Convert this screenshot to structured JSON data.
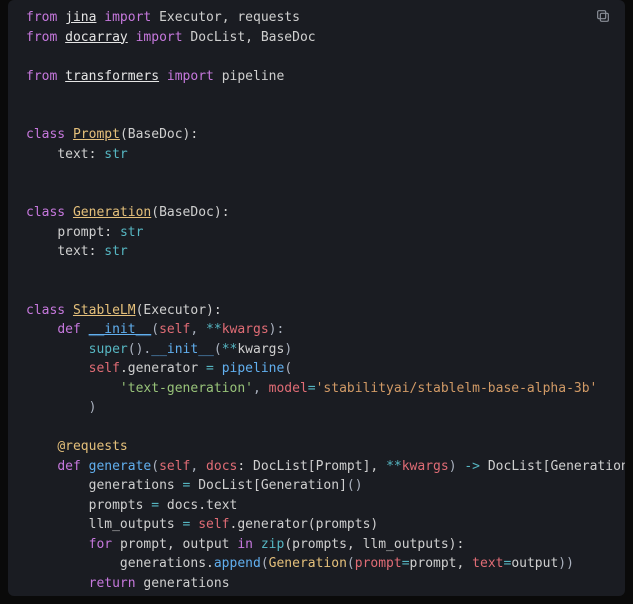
{
  "lines": {
    "l1_from": "from ",
    "l1_mod": "jina",
    "l1_imp": " import ",
    "l1_sym": "Executor, requests",
    "l2_from": "from ",
    "l2_mod": "docarray",
    "l2_imp": " import ",
    "l2_sym": "DocList, BaseDoc",
    "l3_from": "from ",
    "l3_mod": "transformers",
    "l3_imp": " import ",
    "l3_sym": "pipeline",
    "l4_class": "class ",
    "l4_name": "Prompt",
    "l4_rest": "(BaseDoc):",
    "l5_ind": "    ",
    "l5_field": "text: ",
    "l5_type": "str",
    "l6_class": "class ",
    "l6_name": "Generation",
    "l6_rest": "(BaseDoc):",
    "l7_ind": "    ",
    "l7_field": "prompt: ",
    "l7_type": "str",
    "l8_ind": "    ",
    "l8_field": "text: ",
    "l8_type": "str",
    "l9_class": "class ",
    "l9_name": "StableLM",
    "l9_rest": "(Executor):",
    "l10_ind": "    ",
    "l10_def": "def ",
    "l10_fn": "__init__",
    "l10_p": "(",
    "l10_self": "self",
    "l10_c": ", ",
    "l10_star": "**",
    "l10_kwargs": "kwargs",
    "l10_end": "):",
    "l11_ind": "        ",
    "l11_super": "super",
    "l11_p1": "().",
    "l11_init": "__init__",
    "l11_p2": "(",
    "l11_star": "**",
    "l11_kwargs": "kwargs",
    "l11_end": ")",
    "l12_ind": "        ",
    "l12_self": "self",
    "l12_dot": ".generator ",
    "l12_eq": "= ",
    "l12_fn": "pipeline",
    "l12_p": "(",
    "l13_ind": "            ",
    "l13_str": "'text-generation'",
    "l13_c": ", ",
    "l13_model": "model",
    "l13_eq": "=",
    "l13_mstr": "'stabilityai/stablelm-base-alpha-3b'",
    "l14_ind": "        ",
    "l14_p": ")",
    "l15_ind": "    ",
    "l15_dec": "@requests",
    "l16_ind": "    ",
    "l16_def": "def ",
    "l16_fn": "generate",
    "l16_p1": "(",
    "l16_self": "self",
    "l16_c1": ", ",
    "l16_docs": "docs",
    "l16_colon": ": DocList[Prompt], ",
    "l16_star": "**",
    "l16_kwargs": "kwargs",
    "l16_p2": ") ",
    "l16_arrow": "-> ",
    "l16_ret": "DocList[Generation]:",
    "l17_ind": "        ",
    "l17_var": "generations ",
    "l17_eq": "= ",
    "l17_expr1": "DocList[Generation]",
    "l17_call": "()",
    "l18_ind": "        ",
    "l18_var": "prompts ",
    "l18_eq": "= ",
    "l18_expr": "docs.text",
    "l19_ind": "        ",
    "l19_var": "llm_outputs ",
    "l19_eq": "= ",
    "l19_self": "self",
    "l19_rest": ".generator(prompts)",
    "l20_ind": "        ",
    "l20_for": "for ",
    "l20_vars": "prompt, output ",
    "l20_in": "in ",
    "l20_zip": "zip",
    "l20_args": "(prompts, llm_outputs):",
    "l21_ind": "            ",
    "l21_a": "generations.",
    "l21_append": "append",
    "l21_p1": "(",
    "l21_gen": "Generation",
    "l21_p2": "(",
    "l21_k1": "prompt",
    "l21_eq1": "=",
    "l21_v1": "prompt, ",
    "l21_k2": "text",
    "l21_eq2": "=",
    "l21_v2": "output",
    "l21_end": "))",
    "l22_ind": "        ",
    "l22_ret": "return ",
    "l22_var": "generations"
  },
  "icons": {
    "copy": "copy-icon"
  }
}
